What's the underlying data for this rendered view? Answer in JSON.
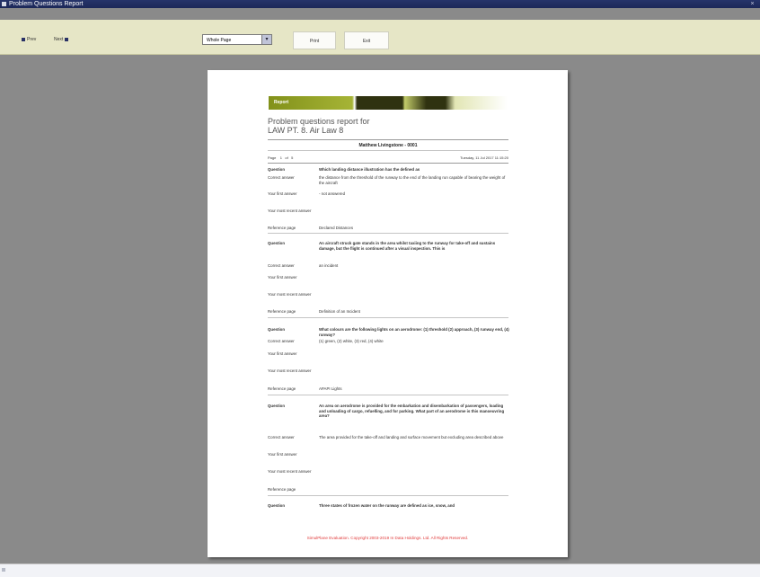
{
  "window": {
    "title": "Problem Questions Report",
    "close_glyph": "×"
  },
  "toolbar": {
    "prev_label": "Prev",
    "next_label": "Next",
    "zoom_value": "Whole Page",
    "zoom_dropdown_glyph": "▾",
    "print_label": "Print",
    "exit_label": "Exit"
  },
  "report": {
    "banner_label": "Report",
    "title_line1": "Problem questions report for",
    "title_line2": "LAW PT. 8. Air Law 8",
    "student_name": "Matthew Livingstone - 0001",
    "page_label": "Page",
    "page_current": "1",
    "page_of": "of",
    "page_total": "5",
    "date": "Tuesday, 11 Jul 2017 11:15:20",
    "questions": [
      {
        "question_label": "Question",
        "question": "Which landing distance illustration has the defined as",
        "correct_label": "Correct answer",
        "correct": "the distance from the threshold of the runway to the end of the landing run capable of bearing the weight of the aircraft",
        "first_label": "Your first answer",
        "first": "- not answered",
        "recent_label": "Your most recent answer",
        "recent": "",
        "ref_label": "Reference page",
        "ref": "Declared Distances"
      },
      {
        "question_label": "Question",
        "question": "An aircraft struck gate stands in the area whilst taxiing to the runway for take-off and sustains damage, but the flight is continued after a visual inspection. This is",
        "correct_label": "Correct answer",
        "correct": "an incident",
        "first_label": "Your first answer",
        "first": "",
        "recent_label": "Your most recent answer",
        "recent": "",
        "ref_label": "Reference page",
        "ref": "Definition of an Incident"
      },
      {
        "question_label": "Question",
        "question": "What colours are the following lights on an aerodrome: (1) threshold (2) approach, (3) runway end, (4) runway?",
        "correct_label": "Correct answer",
        "correct": "(1) green, (2) white, (3) red, (4) white",
        "first_label": "Your first answer",
        "first": "",
        "recent_label": "Your most recent answer",
        "recent": "",
        "ref_label": "Reference page",
        "ref": "APAPI Lights"
      },
      {
        "question_label": "Question",
        "question": "An area on aerodrome is provided for the embarkation and disembarkation of passengers, loading and unloading of cargo, refuelling, and for parking. What part of an aerodrome is this manoeuvring area?",
        "correct_label": "Correct answer",
        "correct": "The area provided for the take-off and landing and surface movement but excluding area described above",
        "first_label": "Your first answer",
        "first": "",
        "recent_label": "Your most recent answer",
        "recent": "",
        "ref_label": "Reference page",
        "ref": ""
      },
      {
        "question_label": "Question",
        "question": "Three states of frozen water on the runway are defined as ice, snow, and"
      }
    ],
    "footer": "SimulPlane Evaluation. Copyright 2003-2019 In Data Holdings. Ltd. All Rights Reserved."
  }
}
